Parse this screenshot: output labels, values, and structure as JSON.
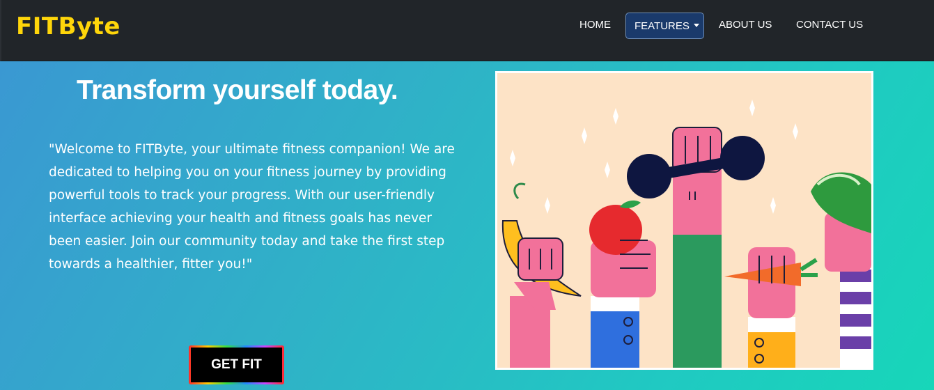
{
  "navbar": {
    "brand": "FITByte",
    "items": [
      {
        "label": "HOME"
      },
      {
        "label": "FEATURES"
      },
      {
        "label": "ABOUT US"
      },
      {
        "label": "CONTACT US"
      }
    ]
  },
  "hero": {
    "title": "Transform yourself today.",
    "text": "\"Welcome to FITByte, your ultimate fitness companion! We are dedicated to helping you on your fitness journey by providing powerful tools to track your progress. With our user-friendly interface achieving your health and fitness goals has never been easier. Join our community today and take the first step towards a healthier, fitter you!\"",
    "cta_label": "GET FIT"
  },
  "colors": {
    "brand": "#ffd60a",
    "navbar_bg": "#212529",
    "hero_gradient_start": "#3a98d2",
    "hero_gradient_end": "#17d6b9"
  },
  "illustration": {
    "icon": "fitness-hands-illustration"
  }
}
